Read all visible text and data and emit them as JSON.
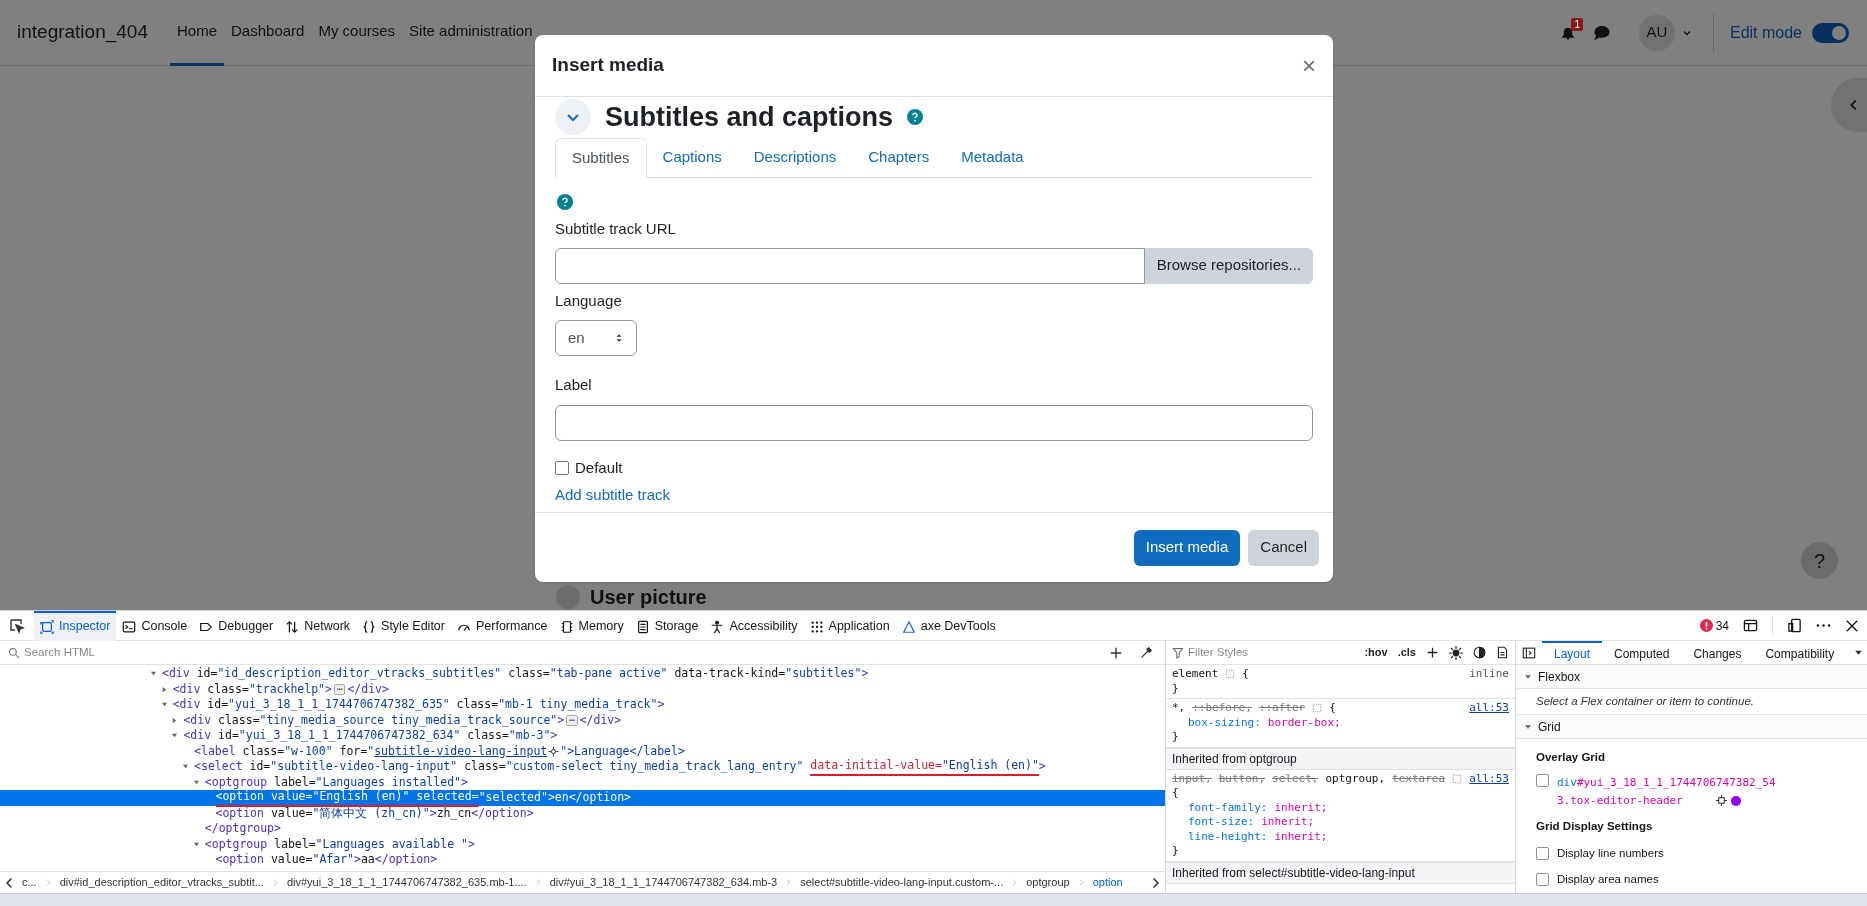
{
  "page": {
    "site_name": "integration_404",
    "nav": [
      {
        "label": "Home",
        "selected": true
      },
      {
        "label": "Dashboard",
        "selected": false
      },
      {
        "label": "My courses",
        "selected": false
      },
      {
        "label": "Site administration",
        "selected": false
      }
    ],
    "notification_count": "1",
    "avatar": "AU",
    "edit_mode": {
      "label": "Edit mode",
      "on": true
    },
    "background_heading": "User picture",
    "help_button": "?"
  },
  "modal": {
    "title": "Insert media",
    "close": "×",
    "section_title": "Subtitles and captions",
    "tabs": [
      {
        "label": "Subtitles",
        "selected": true
      },
      {
        "label": "Captions",
        "selected": false
      },
      {
        "label": "Descriptions",
        "selected": false
      },
      {
        "label": "Chapters",
        "selected": false
      },
      {
        "label": "Metadata",
        "selected": false
      }
    ],
    "url_label": "Subtitle track URL",
    "browse_button": "Browse repositories...",
    "language_label": "Language",
    "language_value": "en",
    "label_label": "Label",
    "default": {
      "label": "Default",
      "checked": false
    },
    "add_link": "Add subtitle track",
    "buttons": [
      {
        "label": "Insert media",
        "kind": "primary"
      },
      {
        "label": "Cancel",
        "kind": "secondary"
      }
    ]
  },
  "devtools": {
    "tabs": [
      {
        "label": "Inspector",
        "selected": true
      },
      {
        "label": "Console",
        "selected": false
      },
      {
        "label": "Debugger",
        "selected": false
      },
      {
        "label": "Network",
        "selected": false
      },
      {
        "label": "Style Editor",
        "selected": false
      },
      {
        "label": "Performance",
        "selected": false
      },
      {
        "label": "Memory",
        "selected": false
      },
      {
        "label": "Storage",
        "selected": false
      },
      {
        "label": "Accessibility",
        "selected": false
      },
      {
        "label": "Application",
        "selected": false
      },
      {
        "label": "axe DevTools",
        "selected": false
      }
    ],
    "error_count": "34",
    "search_placeholder": "Search HTML",
    "tree": [
      {
        "selected": false,
        "expanded": true,
        "segments": [
          {
            "kind": "code",
            "marked": false,
            "s": "<div id=\"id_description_editor_vtracks_subtitles\" class=\"tab-pane active\" data-track-kind=\"subtitles\">"
          }
        ],
        "children": [
          {
            "selected": false,
            "expanded": false,
            "segments": [
              {
                "kind": "code",
                "marked": false,
                "s": "<div class=\"trackhelp\">"
              },
              {
                "kind": "badge",
                "marked": false,
                "s": "⋯"
              },
              {
                "kind": "code",
                "marked": false,
                "s": "</div>"
              }
            ]
          },
          {
            "selected": false,
            "expanded": true,
            "segments": [
              {
                "kind": "code",
                "marked": false,
                "s": "<div id=\"yui_3_18_1_1_1744706747382_635\" class=\"mb-1 tiny_media_track\">"
              }
            ],
            "children": [
              {
                "selected": false,
                "expanded": false,
                "segments": [
                  {
                    "kind": "code",
                    "marked": false,
                    "s": "<div class=\"tiny_media_source tiny_media_track_source\">"
                  },
                  {
                    "kind": "badge",
                    "marked": false,
                    "s": "⋯"
                  },
                  {
                    "kind": "code",
                    "marked": false,
                    "s": "</div>"
                  }
                ]
              },
              {
                "selected": false,
                "expanded": true,
                "segments": [
                  {
                    "kind": "code",
                    "marked": false,
                    "s": "<div id=\"yui_3_18_1_1_1744706747382_634\" class=\"mb-3\">"
                  }
                ],
                "children": [
                  {
                    "selected": false,
                    "segments": [
                      {
                        "kind": "code",
                        "marked": false,
                        "s": "<label class=\"w-100\" for=\""
                      },
                      {
                        "kind": "link",
                        "marked": false,
                        "s": "subtitle-video-lang-input"
                      },
                      {
                        "kind": "code",
                        "marked": false,
                        "s": "\">Language</label>"
                      }
                    ]
                  },
                  {
                    "selected": false,
                    "expanded": true,
                    "segments": [
                      {
                        "kind": "code",
                        "marked": false,
                        "s": "<select id=\"subtitle-video-lang-input\" class=\"custom-select tiny_media_track_lang_entry\" "
                      },
                      {
                        "kind": "code",
                        "marked": true,
                        "s": "data-initial-value=\"English (en)\""
                      },
                      {
                        "kind": "code",
                        "marked": false,
                        "s": ">"
                      }
                    ],
                    "children": [
                      {
                        "selected": false,
                        "expanded": true,
                        "segments": [
                          {
                            "kind": "code",
                            "marked": false,
                            "s": "<optgroup label=\"Languages installed\">"
                          }
                        ],
                        "children": [
                          {
                            "selected": true,
                            "segments": [
                              {
                                "kind": "code",
                                "marked": true,
                                "s": "<option value=\"English (en)\" selected="
                              },
                              {
                                "kind": "code",
                                "marked": false,
                                "s": "\"selected\">en</option>"
                              }
                            ]
                          },
                          {
                            "selected": false,
                            "segments": [
                              {
                                "kind": "code",
                                "marked": false,
                                "s": "<option value=\"简体中文 (zh_cn)\">zh_cn</option>"
                              }
                            ]
                          }
                        ]
                      },
                      {
                        "selected": false,
                        "segments": [
                          {
                            "kind": "code",
                            "marked": false,
                            "s": "</optgroup>"
                          }
                        ]
                      },
                      {
                        "selected": false,
                        "expanded": true,
                        "segments": [
                          {
                            "kind": "code",
                            "marked": false,
                            "s": "<optgroup label=\"Languages available \">"
                          }
                        ],
                        "children": [
                          {
                            "selected": false,
                            "segments": [
                              {
                                "kind": "code",
                                "marked": false,
                                "s": "<option value=\"Afar\">aa</option>"
                              }
                            ]
                          }
                        ]
                      }
                    ]
                  }
                ]
              }
            ]
          }
        ]
      }
    ],
    "breadcrumbs": [
      {
        "label": "c...",
        "selected": false
      },
      {
        "label": "div#id_description_editor_vtracks_subtit...",
        "selected": false
      },
      {
        "label": "div#yui_3_18_1_1_1744706747382_635.mb-1....",
        "selected": false
      },
      {
        "label": "div#yui_3_18_1_1_1744706747382_634.mb-3",
        "selected": false
      },
      {
        "label": "select#subtitle-video-lang-input.custom-...",
        "selected": false
      },
      {
        "label": "optgroup",
        "selected": false
      },
      {
        "label": "option",
        "selected": true
      }
    ],
    "styles": {
      "filter_placeholder": "Filter Styles",
      "toggles": [
        ":hov",
        ".cls"
      ],
      "items": [
        {
          "kind": "rule",
          "selectors": [
            {
              "s": "element",
              "struck": false
            }
          ],
          "open": "{",
          "source": "inline",
          "source_link": false,
          "close": "}"
        },
        {
          "kind": "rule",
          "selectors": [
            {
              "s": "*,",
              "struck": false
            },
            {
              "s": "::before,",
              "struck": true
            },
            {
              "s": "::after",
              "struck": true
            }
          ],
          "open": "{",
          "source": "all:53",
          "source_link": true,
          "declarations": [
            {
              "prop": "box-sizing:",
              "value": "border-box;"
            }
          ],
          "close": "}"
        },
        {
          "kind": "inherited",
          "label": "Inherited from optgroup"
        },
        {
          "kind": "rule",
          "selectors": [
            {
              "s": "input,",
              "struck": true
            },
            {
              "s": "button,",
              "struck": true
            },
            {
              "s": "select,",
              "struck": true
            },
            {
              "s": "optgroup,",
              "struck": false
            },
            {
              "s": "textarea",
              "struck": true
            }
          ],
          "open": "{",
          "source": "all:53",
          "source_link": true,
          "declarations": [
            {
              "prop": "font-family:",
              "value": "inherit;"
            },
            {
              "prop": "font-size:",
              "value": "inherit;"
            },
            {
              "prop": "line-height:",
              "value": "inherit;"
            }
          ],
          "close": "}"
        },
        {
          "kind": "inherited",
          "label": "Inherited from select#subtitle-video-lang-input"
        }
      ]
    },
    "layout": {
      "tabs": [
        {
          "label": "Layout",
          "selected": true
        },
        {
          "label": "Computed",
          "selected": false
        },
        {
          "label": "Changes",
          "selected": false
        },
        {
          "label": "Compatibility",
          "selected": false
        }
      ],
      "flexbox": {
        "title": "Flexbox",
        "expanded": true,
        "message": "Select a Flex container or item to continue."
      },
      "grid": {
        "title": "Grid",
        "expanded": true,
        "overlay_title": "Overlay Grid",
        "overlay_items": [
          {
            "tag": "div",
            "selector": "#yui_3_18_1_1_1744706747382_543.tox-editor-header",
            "checked": false,
            "color": "#9400ff"
          }
        ],
        "settings_title": "Grid Display Settings",
        "settings": [
          {
            "label": "Display line numbers",
            "checked": false
          },
          {
            "label": "Display area names",
            "checked": false
          }
        ]
      }
    }
  }
}
